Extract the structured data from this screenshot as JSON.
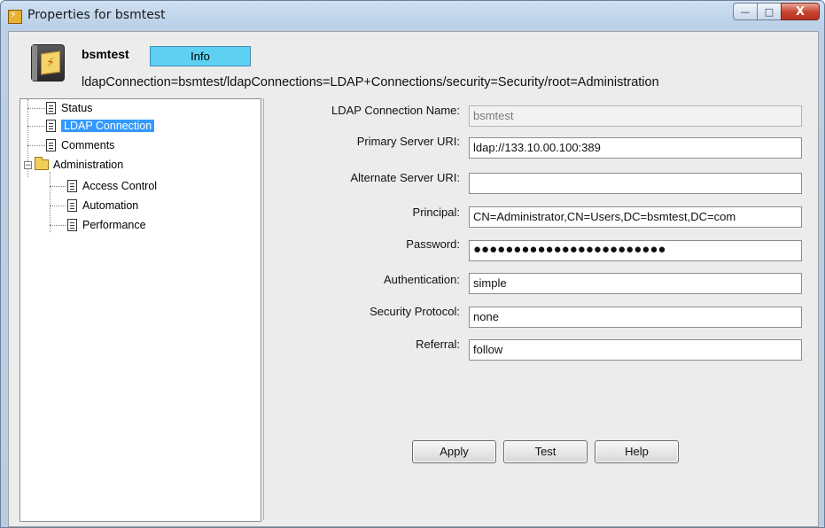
{
  "window": {
    "title": "Properties for bsmtest",
    "controls": {
      "minimize": "—",
      "maximize": "□",
      "close": "X"
    }
  },
  "header": {
    "object_name": "bsmtest",
    "badge": "Info",
    "dn": "ldapConnection=bsmtest/ldapConnections=LDAP+Connections/security=Security/root=Administration",
    "icon": "ldap-connection-icon"
  },
  "tree": {
    "items": [
      {
        "label": "Status",
        "icon": "document-icon"
      },
      {
        "label": "LDAP Connection",
        "icon": "document-icon",
        "selected": true
      },
      {
        "label": "Comments",
        "icon": "document-icon"
      },
      {
        "label": "Administration",
        "icon": "folder-icon",
        "expanded": true
      },
      {
        "label": "Access Control",
        "icon": "document-icon"
      },
      {
        "label": "Automation",
        "icon": "document-icon"
      },
      {
        "label": "Performance",
        "icon": "document-icon"
      }
    ]
  },
  "form": {
    "fields": [
      {
        "label": "LDAP Connection Name:",
        "value": "bsmtest",
        "disabled": true
      },
      {
        "label": "Primary Server URI:",
        "value": "ldap://133.10.00.100:389"
      },
      {
        "label": "Alternate Server URI:",
        "value": ""
      },
      {
        "label": "Principal:",
        "value": "CN=Administrator,CN=Users,DC=bsmtest,DC=com"
      },
      {
        "label": "Password:",
        "value": "●●●●●●●●●●●●●●●●●●●●●●●●"
      },
      {
        "label": "Authentication:",
        "value": "simple"
      },
      {
        "label": "Security Protocol:",
        "value": "none"
      },
      {
        "label": "Referral:",
        "value": "follow"
      }
    ]
  },
  "buttons": {
    "apply": "Apply",
    "test": "Test",
    "help": "Help"
  },
  "colors": {
    "badge": "#5ed0f2",
    "selection": "#3399ff",
    "close": "#c7412c"
  }
}
